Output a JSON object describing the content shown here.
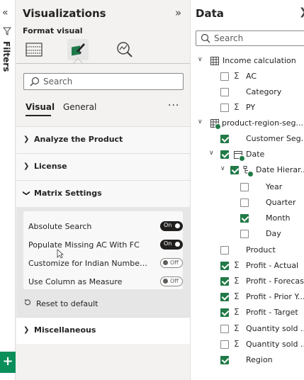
{
  "filters": {
    "label": "Filters"
  },
  "viz": {
    "title": "Visualizations",
    "format_label": "Format visual",
    "search_placeholder": "Search",
    "tabs": [
      "Visual",
      "General"
    ],
    "more": "···",
    "sections": {
      "analyze": "Analyze the Product",
      "license": "License",
      "matrix": "Matrix Settings",
      "misc": "Miscellaneous"
    },
    "matrix_settings": [
      {
        "label": "Absolute Search",
        "state": "On"
      },
      {
        "label": "Populate Missing AC With FC",
        "state": "On"
      },
      {
        "label": "Customize for Indian Numbering System",
        "state": "Off"
      },
      {
        "label": "Use Column as Measure",
        "state": "Off"
      }
    ],
    "reset_label": "Reset to default"
  },
  "data": {
    "title": "Data",
    "search_placeholder": "Search",
    "rows": {
      "income": "Income calculation",
      "ac": "AC",
      "category": "Category",
      "py": "PY",
      "prs": "product-region-seg...",
      "customer": "Customer Seg...",
      "date": "Date",
      "datehier": "Date Hierar...",
      "year": "Year",
      "quarter": "Quarter",
      "month": "Month",
      "day": "Day",
      "product": "Product",
      "profit_actual": "Profit - Actual",
      "profit_forecast": "Profit - Forecast",
      "profit_prior": "Profit - Prior Y...",
      "profit_target": "Profit - Target",
      "qty1": "Quantity sold ...",
      "qty2": "Quantity sold ...",
      "region": "Region"
    }
  }
}
